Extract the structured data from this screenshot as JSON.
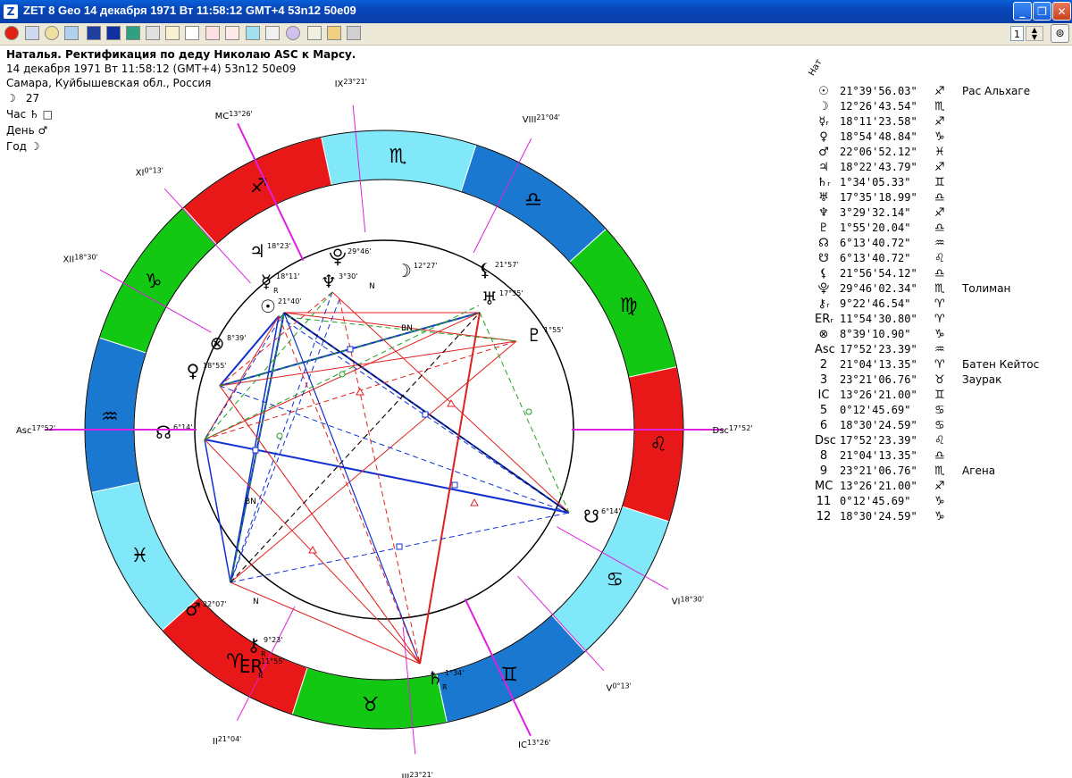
{
  "window": {
    "title": "ZET 8 Geo   14 декабря 1971  Вт  11:58:12 GMT+4 53n12  50e09",
    "app_icon": "Z",
    "btn_min": "_",
    "btn_max": "❐",
    "btn_close": "✕"
  },
  "toolbar": {
    "page_number": "1",
    "end_icon": "⊚"
  },
  "header": {
    "name_line": "Наталья. Ректификация по деду Николаю ASC к Марсу.",
    "date_line": "14 декабря 1971  Вт  11:58:12 (GMT+4) 53n12  50e09",
    "place_line": "Самара, Куйбышевская обл., Россия",
    "moon_day_glyph": "☽",
    "moon_day": "27",
    "hour_label": "Час",
    "hour_glyph": "♄",
    "hour_mark": "□",
    "day_label": "День",
    "day_glyph": "♂",
    "year_label": "Год",
    "year_glyph": "☽"
  },
  "table": {
    "natal_label": "Нат",
    "rows": [
      {
        "glyph": "☉",
        "value": "21°39'56.03\"",
        "sign": "♐",
        "star": "Рас Альхаге"
      },
      {
        "glyph": "☽",
        "value": "12°26'43.54\"",
        "sign": "♏",
        "star": ""
      },
      {
        "glyph": "☿ᵣ",
        "value": "18°11'23.58\"",
        "sign": "♐",
        "star": ""
      },
      {
        "glyph": "♀",
        "value": "18°54'48.84\"",
        "sign": "♑",
        "star": ""
      },
      {
        "glyph": "♂",
        "value": "22°06'52.12\"",
        "sign": "♓",
        "star": ""
      },
      {
        "glyph": "♃",
        "value": "18°22'43.79\"",
        "sign": "♐",
        "star": ""
      },
      {
        "glyph": "♄ᵣ",
        "value": " 1°34'05.33\"",
        "sign": "♊",
        "star": ""
      },
      {
        "glyph": "♅",
        "value": "17°35'18.99\"",
        "sign": "♎",
        "star": ""
      },
      {
        "glyph": "♆",
        "value": " 3°29'32.14\"",
        "sign": "♐",
        "star": ""
      },
      {
        "glyph": "♇",
        "value": " 1°55'20.04\"",
        "sign": "♎",
        "star": ""
      },
      {
        "glyph": "☊",
        "value": " 6°13'40.72\"",
        "sign": "♒",
        "star": ""
      },
      {
        "glyph": "☋",
        "value": " 6°13'40.72\"",
        "sign": "♌",
        "star": ""
      },
      {
        "glyph": "⚸",
        "value": "21°56'54.12\"",
        "sign": "♎",
        "star": ""
      },
      {
        "glyph": "⯓",
        "value": "29°46'02.34\"",
        "sign": "♏",
        "star": "Толиман"
      },
      {
        "glyph": "⚷ᵣ",
        "value": " 9°22'46.54\"",
        "sign": "♈",
        "star": ""
      },
      {
        "glyph": "ERᵣ",
        "value": "11°54'30.80\"",
        "sign": "♈",
        "star": ""
      },
      {
        "glyph": "⊗",
        "value": " 8°39'10.90\"",
        "sign": "♑",
        "star": ""
      },
      {
        "glyph": "Asc",
        "value": "17°52'23.39\"",
        "sign": "♒",
        "star": ""
      },
      {
        "glyph": "2",
        "value": "21°04'13.35\"",
        "sign": "♈",
        "star": "Батен Кейтос"
      },
      {
        "glyph": "3",
        "value": "23°21'06.76\"",
        "sign": "♉",
        "star": "Заурак"
      },
      {
        "glyph": "IC",
        "value": "13°26'21.00\"",
        "sign": "♊",
        "star": ""
      },
      {
        "glyph": "5",
        "value": " 0°12'45.69\"",
        "sign": "♋",
        "star": ""
      },
      {
        "glyph": "6",
        "value": "18°30'24.59\"",
        "sign": "♋",
        "star": ""
      },
      {
        "glyph": "Dsc",
        "value": "17°52'23.39\"",
        "sign": "♌",
        "star": ""
      },
      {
        "glyph": "8",
        "value": "21°04'13.35\"",
        "sign": "♎",
        "star": ""
      },
      {
        "glyph": "9",
        "value": "23°21'06.76\"",
        "sign": "♏",
        "star": "Агена"
      },
      {
        "glyph": "MC",
        "value": "13°26'21.00\"",
        "sign": "♐",
        "star": ""
      },
      {
        "glyph": "11",
        "value": " 0°12'45.69\"",
        "sign": "♑",
        "star": ""
      },
      {
        "glyph": "12",
        "value": "18°30'24.59\"",
        "sign": "♑",
        "star": ""
      }
    ]
  },
  "chart": {
    "signs": [
      {
        "glyph": "♒",
        "color": "#1a78d0"
      },
      {
        "glyph": "♑",
        "color": "#12c812"
      },
      {
        "glyph": "♐",
        "color": "#e81818"
      },
      {
        "glyph": "♏",
        "color": "#80e8f8"
      },
      {
        "glyph": "♎",
        "color": "#1a78d0"
      },
      {
        "glyph": "♍",
        "color": "#12c812"
      },
      {
        "glyph": "♌",
        "color": "#e81818"
      },
      {
        "glyph": "♋",
        "color": "#80e8f8"
      },
      {
        "glyph": "♊",
        "color": "#1a78d0"
      },
      {
        "glyph": "♉",
        "color": "#12c812"
      },
      {
        "glyph": "♈",
        "color": "#e81818"
      },
      {
        "glyph": "♓",
        "color": "#80e8f8"
      }
    ],
    "house_labels": [
      {
        "text": "Asc",
        "deg": "17°52'"
      },
      {
        "text": "II",
        "deg": "21°04'"
      },
      {
        "text": "III",
        "deg": "23°21'"
      },
      {
        "text": "IC",
        "deg": "13°26'"
      },
      {
        "text": "V",
        "deg": "0°13'"
      },
      {
        "text": "VI",
        "deg": "18°30'"
      },
      {
        "text": "Dsc",
        "deg": "17°52'"
      },
      {
        "text": "VIII",
        "deg": "21°04'"
      },
      {
        "text": "IX",
        "deg": "23°21'"
      },
      {
        "text": "MC",
        "deg": "13°26'"
      },
      {
        "text": "XI",
        "deg": "0°13'"
      },
      {
        "text": "XII",
        "deg": "18°30'"
      }
    ],
    "planets": [
      {
        "glyph": "♃",
        "deg": "18°23'"
      },
      {
        "glyph": "⯓",
        "deg": "29°46'"
      },
      {
        "glyph": "☿",
        "deg": "18°11'",
        "retro": "R"
      },
      {
        "glyph": "♆",
        "deg": "3°30'"
      },
      {
        "glyph": "☽",
        "deg": "12°27'"
      },
      {
        "glyph": "⚸",
        "deg": "21°57'"
      },
      {
        "glyph": "♅",
        "deg": "17°35'"
      },
      {
        "glyph": "☉",
        "deg": "21°40'"
      },
      {
        "glyph": "♇",
        "deg": "1°55'"
      },
      {
        "glyph": "⊗",
        "deg": "8°39'"
      },
      {
        "glyph": "♀",
        "deg": "18°55'"
      },
      {
        "glyph": "☊",
        "deg": "6°14'"
      },
      {
        "glyph": "☋",
        "deg": "6°14'"
      },
      {
        "glyph": "♂",
        "deg": "22°07'"
      },
      {
        "glyph": "⚷",
        "deg": "9°23'",
        "retro": "R"
      },
      {
        "glyph": "ER",
        "deg": "11°55'",
        "retro": "R"
      },
      {
        "glyph": "♄",
        "deg": "1°34'",
        "retro": "R"
      }
    ],
    "markers": {
      "bn1": "BN",
      "bn2": "BN",
      "n1": "N",
      "n2": "N"
    }
  }
}
